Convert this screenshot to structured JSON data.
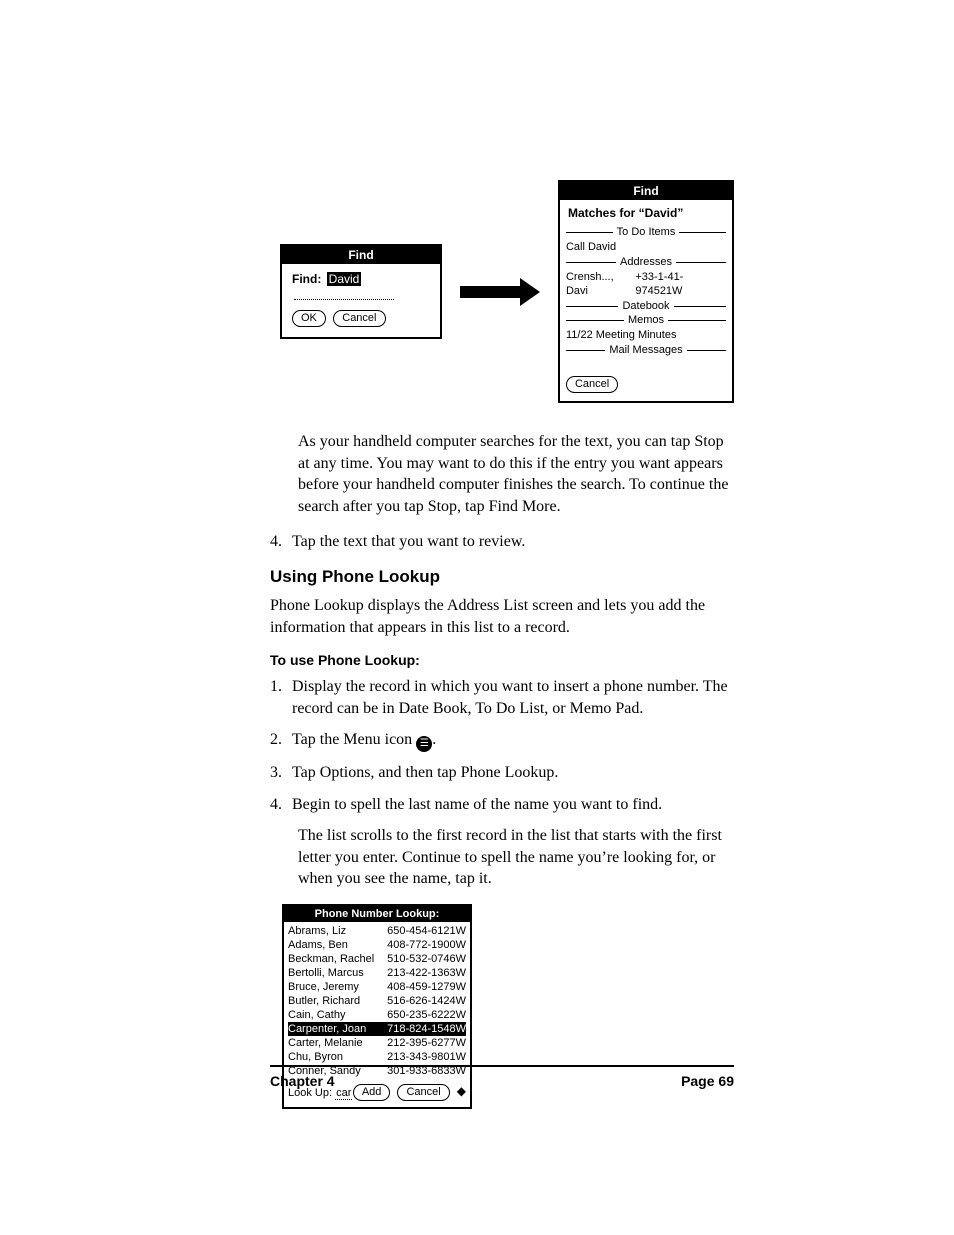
{
  "find_dialog": {
    "title": "Find",
    "label": "Find:",
    "query": "David",
    "ok": "OK",
    "cancel": "Cancel"
  },
  "results_dialog": {
    "title": "Find",
    "matches_label": "Matches for  “David”",
    "sections": {
      "todo": "To Do Items",
      "addresses": "Addresses",
      "datebook": "Datebook",
      "memos": "Memos",
      "mail": "Mail Messages"
    },
    "todo_item": "Call David",
    "address_name": "Crensh..., Davi",
    "address_phone": "+33-1-41-974521W",
    "memo_item": "11/22 Meeting Minutes",
    "cancel": "Cancel"
  },
  "body": {
    "para1": "As your handheld computer searches for the text, you can tap Stop at any time. You may want to do this if the entry you want appears before your handheld computer finishes the search. To continue the search after you tap Stop, tap Find More.",
    "step4": "Tap the text that you want to review.",
    "h3": "Using Phone Lookup",
    "para2": "Phone Lookup displays the Address List screen and lets you add the information that appears in this list to a record.",
    "h4": "To use Phone Lookup:",
    "pl_step1": "Display the record in which you want to insert a phone number. The record can be in Date Book, To Do List, or Memo Pad.",
    "pl_step2_a": "Tap the Menu icon ",
    "pl_step2_b": ".",
    "pl_step3": "Tap Options, and then tap Phone Lookup.",
    "pl_step4": "Begin to spell the last name of the name you want to find.",
    "para3": "The list scrolls to the first record in the list that starts with the first letter you enter. Continue to spell the name you’re looking for, or when you see the name, tap it."
  },
  "lookup": {
    "title": "Phone Number Lookup:",
    "rows": [
      {
        "name": "Abrams, Liz",
        "phone": "650-454-6121W"
      },
      {
        "name": "Adams, Ben",
        "phone": "408-772-1900W"
      },
      {
        "name": "Beckman, Rachel",
        "phone": "510-532-0746W"
      },
      {
        "name": "Bertolli, Marcus",
        "phone": "213-422-1363W"
      },
      {
        "name": "Bruce, Jeremy",
        "phone": "408-459-1279W"
      },
      {
        "name": "Butler, Richard",
        "phone": "516-626-1424W"
      },
      {
        "name": "Cain, Cathy",
        "phone": "650-235-6222W"
      },
      {
        "name": "Carpenter, Joan",
        "phone": "718-824-1548W"
      },
      {
        "name": "Carter, Melanie",
        "phone": "212-395-6277W"
      },
      {
        "name": "Chu, Byron",
        "phone": "213-343-9801W"
      },
      {
        "name": "Conner, Sandy",
        "phone": "301-933-6833W"
      }
    ],
    "selected_index": 7,
    "lookup_label": "Look Up:",
    "lookup_query": "car",
    "add": "Add",
    "cancel": "Cancel"
  },
  "footer": {
    "left": "Chapter 4",
    "right": "Page 69"
  }
}
